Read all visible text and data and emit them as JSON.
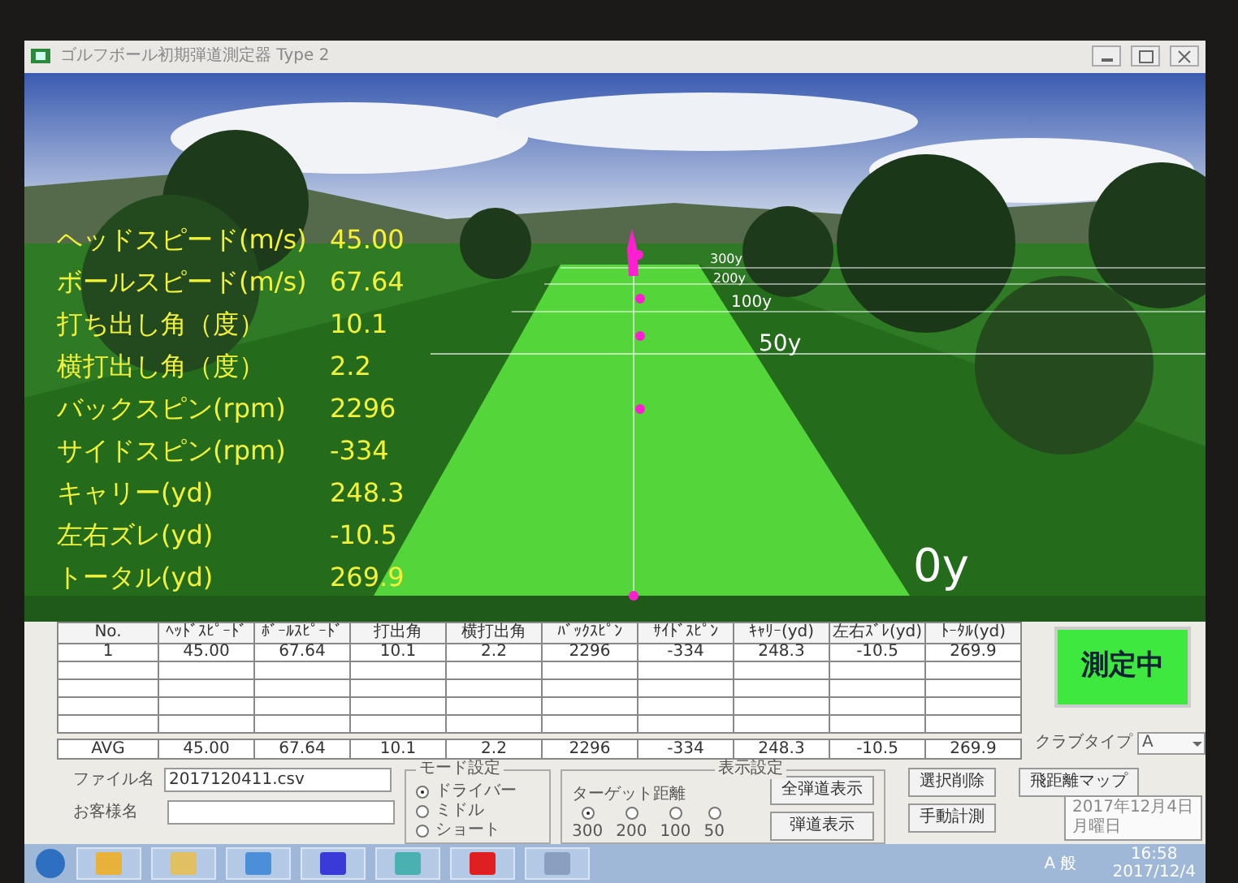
{
  "window": {
    "title": "ゴルフボール初期弾道測定器 Type 2"
  },
  "scene": {
    "distance_labels": [
      "300y",
      "200y",
      "100y",
      "50y",
      "0y"
    ],
    "readouts": [
      {
        "label": "ヘッドスピード(m/s)",
        "value": "45.00"
      },
      {
        "label": "ボールスピード(m/s)",
        "value": "67.64"
      },
      {
        "label": "打ち出し角（度）",
        "value": "10.1"
      },
      {
        "label": "横打出し角（度）",
        "value": "2.2"
      },
      {
        "label": "バックスピン(rpm)",
        "value": "2296"
      },
      {
        "label": "サイドスピン(rpm)",
        "value": "-334"
      },
      {
        "label": "キャリー(yd)",
        "value": "248.3"
      },
      {
        "label": "左右ズレ(yd)",
        "value": "-10.5"
      },
      {
        "label": "トータル(yd)",
        "value": "269.9"
      }
    ]
  },
  "results_table": {
    "columns": [
      "No.",
      "ﾍｯﾄﾞｽﾋﾟｰﾄﾞ",
      "ﾎﾞｰﾙｽﾋﾟｰﾄﾞ",
      "打出角",
      "横打出角",
      "ﾊﾞｯｸｽﾋﾟﾝ",
      "ｻｲﾄﾞｽﾋﾟﾝ",
      "ｷｬﾘｰ(yd)",
      "左右ｽﾞﾚ(yd)",
      "ﾄｰﾀﾙ(yd)"
    ],
    "rows": [
      [
        "1",
        "45.00",
        "67.64",
        "10.1",
        "2.2",
        "2296",
        "-334",
        "248.3",
        "-10.5",
        "269.9"
      ]
    ],
    "avg_row": [
      "AVG",
      "45.00",
      "67.64",
      "10.1",
      "2.2",
      "2296",
      "-334",
      "248.3",
      "-10.5",
      "269.9"
    ]
  },
  "status_button": {
    "label": "測定中",
    "active": true
  },
  "club_type": {
    "label": "クラブタイプ",
    "value": "A"
  },
  "file_name": {
    "label": "ファイル名",
    "value": "2017120411.csv"
  },
  "customer_name": {
    "label": "お客様名"
  },
  "mode_settings": {
    "title": "モード設定",
    "options": [
      {
        "label": "ドライバー",
        "selected": true
      },
      {
        "label": "ミドル",
        "selected": false
      },
      {
        "label": "ショート",
        "selected": false
      }
    ]
  },
  "display_settings": {
    "title": "表示設定",
    "target_label": "ターゲット距離",
    "targets": [
      {
        "label": "300",
        "selected": true
      },
      {
        "label": "200",
        "selected": false
      },
      {
        "label": "100",
        "selected": false
      },
      {
        "label": "50",
        "selected": false
      }
    ],
    "buttons": [
      "全弾道表示",
      "弾道表示"
    ]
  },
  "action_buttons": [
    "選択削除",
    "手動計測"
  ],
  "map_button": "飛距離マップ",
  "tooltip": {
    "lines": [
      "2017年12月4日",
      "月曜日"
    ]
  },
  "taskbar": {
    "ime": "A 般",
    "time": "16:58",
    "date": "2017/12/4"
  }
}
